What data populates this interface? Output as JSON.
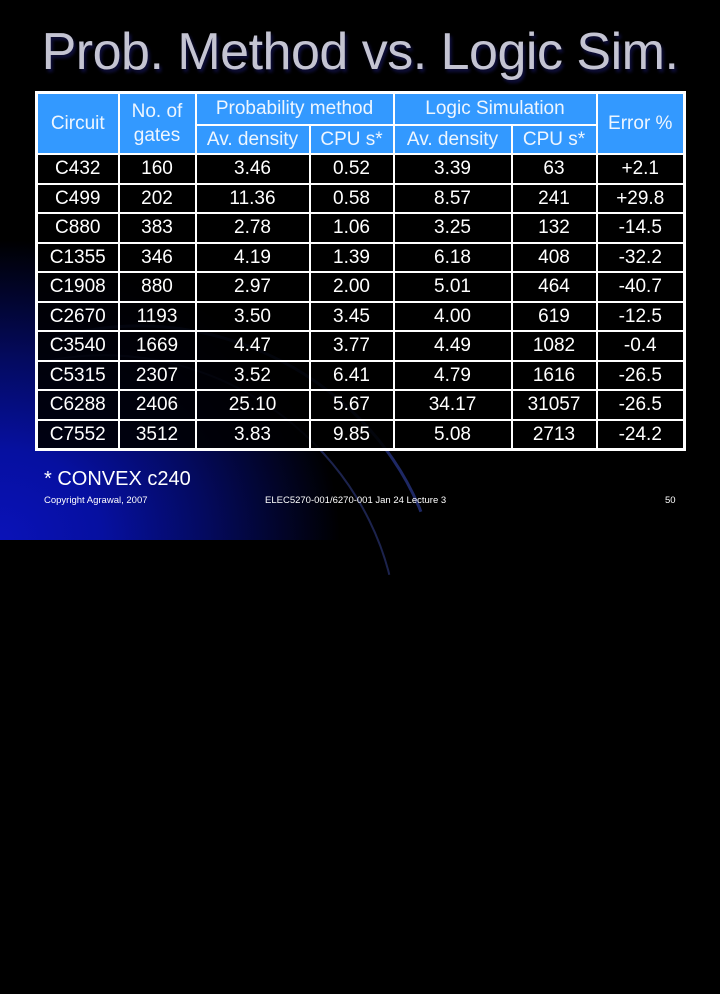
{
  "slide": {
    "title": "Prob. Method vs. Logic Sim.",
    "footnote": "* CONVEX c240",
    "footer_left": "Copyright Agrawal, 2007",
    "footer_center": "ELEC5270-001/6270-001 Jan 24 Lecture 3",
    "page_number": "50"
  },
  "table": {
    "headers": {
      "circuit": "Circuit",
      "gates": "No. of gates",
      "prob_group": "Probability method",
      "logic_group": "Logic Simulation",
      "error": "Error %",
      "prob_density": "Av. density",
      "prob_cpu": "CPU s*",
      "logic_density": "Av. density",
      "logic_cpu": "CPU s*"
    },
    "rows": [
      {
        "circuit": "C432",
        "gates": "160",
        "prob_density": "3.46",
        "prob_cpu": "0.52",
        "logic_density": "3.39",
        "logic_cpu": "63",
        "error": "+2.1"
      },
      {
        "circuit": "C499",
        "gates": "202",
        "prob_density": "11.36",
        "prob_cpu": "0.58",
        "logic_density": "8.57",
        "logic_cpu": "241",
        "error": "+29.8"
      },
      {
        "circuit": "C880",
        "gates": "383",
        "prob_density": "2.78",
        "prob_cpu": "1.06",
        "logic_density": "3.25",
        "logic_cpu": "132",
        "error": "-14.5"
      },
      {
        "circuit": "C1355",
        "gates": "346",
        "prob_density": "4.19",
        "prob_cpu": "1.39",
        "logic_density": "6.18",
        "logic_cpu": "408",
        "error": "-32.2"
      },
      {
        "circuit": "C1908",
        "gates": "880",
        "prob_density": "2.97",
        "prob_cpu": "2.00",
        "logic_density": "5.01",
        "logic_cpu": "464",
        "error": "-40.7"
      },
      {
        "circuit": "C2670",
        "gates": "1193",
        "prob_density": "3.50",
        "prob_cpu": "3.45",
        "logic_density": "4.00",
        "logic_cpu": "619",
        "error": "-12.5"
      },
      {
        "circuit": "C3540",
        "gates": "1669",
        "prob_density": "4.47",
        "prob_cpu": "3.77",
        "logic_density": "4.49",
        "logic_cpu": "1082",
        "error": "-0.4"
      },
      {
        "circuit": "C5315",
        "gates": "2307",
        "prob_density": "3.52",
        "prob_cpu": "6.41",
        "logic_density": "4.79",
        "logic_cpu": "1616",
        "error": "-26.5"
      },
      {
        "circuit": "C6288",
        "gates": "2406",
        "prob_density": "25.10",
        "prob_cpu": "5.67",
        "logic_density": "34.17",
        "logic_cpu": "31057",
        "error": "-26.5"
      },
      {
        "circuit": "C7552",
        "gates": "3512",
        "prob_density": "3.83",
        "prob_cpu": "9.85",
        "logic_density": "5.08",
        "logic_cpu": "2713",
        "error": "-24.2"
      }
    ]
  },
  "colors": {
    "header_bg": "#3399ff",
    "title_text": "#c4c4d2",
    "background": "#000000",
    "accent_glow": "#0a12b8"
  }
}
